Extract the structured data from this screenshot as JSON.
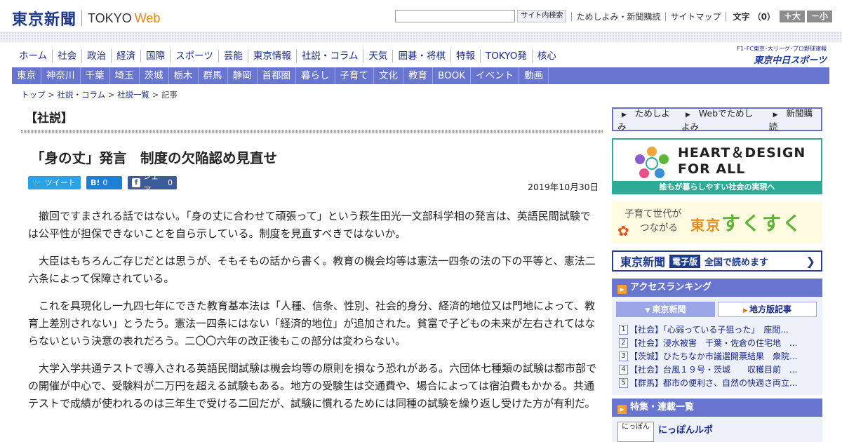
{
  "header": {
    "logo_jp": "東京新聞",
    "logo_en": "TOKYO",
    "logo_web": "Web",
    "search_placeholder": "",
    "search_button": "サイト内検索",
    "link_trial": "ためしよみ・新聞購読",
    "link_sitemap": "サイトマップ",
    "font_label": "文字",
    "font_value": "（0）",
    "font_larger": "＋大",
    "font_smaller": "－小"
  },
  "nav_main": [
    "ホーム",
    "社会",
    "政治",
    "経済",
    "国際",
    "スポーツ",
    "芸能",
    "東京情報",
    "社説・コラム",
    "天気",
    "囲碁・将棋",
    "特報",
    "TOKYO発",
    "核心"
  ],
  "nav_chunichi": {
    "small": "F1･FC東京･大リーグ･プロ野球速報",
    "big": "東京中日スポーツ"
  },
  "nav_region": [
    "東京",
    "神奈川",
    "千葉",
    "埼玉",
    "茨城",
    "栃木",
    "群馬",
    "静岡",
    "首都圏",
    "暮らし",
    "子育て",
    "文化",
    "教育",
    "BOOK",
    "イベント",
    "動画"
  ],
  "breadcrumb": {
    "top": "トップ",
    "column": "社説・コラム",
    "list": "社説一覧",
    "current": "記事",
    "sep": " > "
  },
  "article": {
    "section": "【社説】",
    "title": "「身の丈」発言　制度の欠陥認め見直せ",
    "date": "2019年10月30日",
    "share": {
      "tweet": "ツイート",
      "hatena_label": "B!",
      "hatena_count": "0",
      "facebook": "シェア",
      "facebook_count": "0"
    },
    "paragraphs": [
      "撤回ですまされる話ではない。「身の丈に合わせて頑張って」という萩生田光一文部科学相の発言は、英語民間試験では公平性が担保できないことを自ら示している。制度を見直すべきではないか。",
      "大臣はもちろんご存じだとは思うが、そもそもの話から書く。教育の機会均等は憲法一四条の法の下の平等と、憲法二六条によって保障されている。",
      "これを具現化し一九四七年にできた教育基本法は「人種、信条、性別、社会的身分、経済的地位又は門地によって、教育上差別されない」とうたう。憲法一四条にはない「経済的地位」が追加された。貧富で子どもの未来が左右されてはならないという決意の表れだろう。二〇〇六年の改正後もこの部分は変わらない。",
      "大学入学共通テストで導入される英語民間試験は機会均等の原則を損なう恐れがある。六団体七種類の試験は都市部での開催が中心で、受験料が二万円を超える試験もある。地方の受験生は交通費や、場合によっては宿泊費もかかる。共通テストで成績が使われるのは三年生で受ける二回だが、試験に慣れるためには同種の試験を繰り返し受けた方が有利だ。"
    ]
  },
  "sidebar": {
    "trial_links": [
      "ためしよみ",
      "Webでためしよみ",
      "新聞購読"
    ],
    "heart_design": {
      "line1": "HEART＆DESIGN",
      "line2": "FOR ALL",
      "sub": "誰もが暮らしやすい社会の実現へ"
    },
    "sukusuku": {
      "small1": "子育て世代が",
      "small2": "つながる",
      "tokyo": "東京",
      "big": "すくすく"
    },
    "denshi": {
      "logo": "東京新聞",
      "badge": "電子版",
      "text": "全国で読めます"
    },
    "ranking": {
      "title": "アクセスランキング",
      "tab_tokyo": "東京新聞",
      "tab_local": "地方版記事",
      "items": [
        {
          "num": "1",
          "text": "【社会】「心弱っている子狙った」　座間..."
        },
        {
          "num": "2",
          "text": "【社会】浸水被害　千葉・佐倉の住宅地　..."
        },
        {
          "num": "3",
          "text": "【茨城】ひたちなか市議選開票結果　衆院..."
        },
        {
          "num": "4",
          "text": "【社会】台風１９号・茨城　　収穫目前　..."
        },
        {
          "num": "5",
          "text": "【群馬】都市の便利さ、自然の快適さ両立..."
        }
      ]
    },
    "features": {
      "title": "特集・連載一覧",
      "item_thumb": "にっぽん",
      "item_title": "にっぽんルポ"
    }
  },
  "colors": {
    "nav_bar": "#6775d0",
    "logo_blue": "#1f3a8a",
    "accent_orange": "#e8860a",
    "heart_teal": "#2eaa96"
  },
  "icons": [
    "search-icon",
    "twitter-icon",
    "hatena-icon",
    "facebook-icon",
    "triangle-icon",
    "chevron-right-icon",
    "flower-icon",
    "heart-design-logo"
  ]
}
